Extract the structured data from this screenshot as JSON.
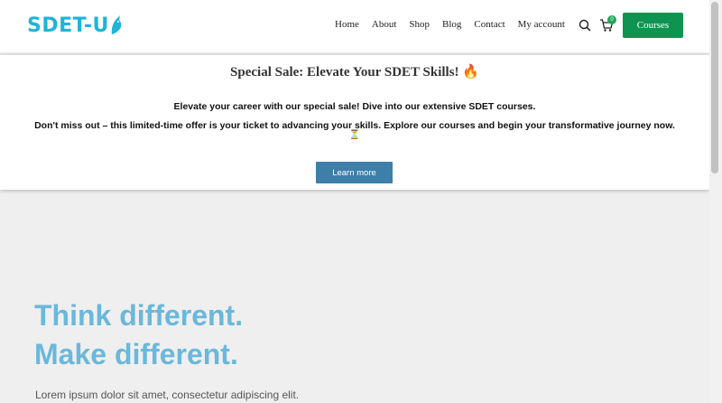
{
  "header": {
    "logo_text": "SDET-U",
    "nav": [
      "Home",
      "About",
      "Shop",
      "Blog",
      "Contact",
      "My account"
    ],
    "cart_count": "0",
    "courses_label": "Courses",
    "colors": {
      "accent": "#0e9450",
      "logo": "#1fb4d8"
    }
  },
  "banner": {
    "title": "Special Sale: Elevate Your SDET Skills! 🔥",
    "line1": "Elevate your career with our special sale! Dive into our extensive SDET courses.",
    "line2": "Don't miss out – this limited-time offer is your ticket to advancing your skills. Explore our courses and begin your transformative journey now.",
    "line3": "⏳",
    "button_label": "Learn more",
    "button_color": "#3d7fa8"
  },
  "hero": {
    "line1": "Think different.",
    "line2": "Make different.",
    "subtitle": "Lorem ipsum dolor sit amet, consectetur adipiscing elit.",
    "color": "#6ab8db"
  }
}
